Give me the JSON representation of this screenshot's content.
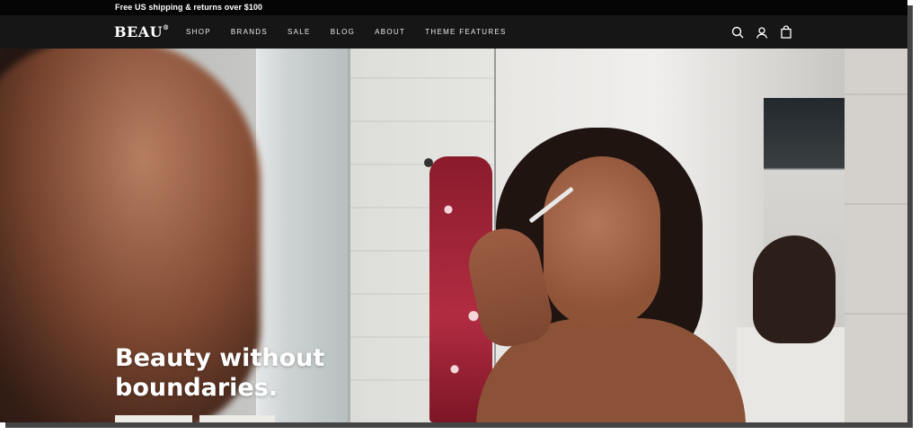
{
  "announcement": {
    "text": "Free US shipping & returns over $100"
  },
  "header": {
    "logo": "BEAU",
    "logo_mark": "®",
    "nav": [
      {
        "label": "SHOP"
      },
      {
        "label": "BRANDS"
      },
      {
        "label": "SALE"
      },
      {
        "label": "BLOG"
      },
      {
        "label": "ABOUT"
      },
      {
        "label": "THEME FEATURES"
      }
    ],
    "icons": [
      "search-icon",
      "account-icon",
      "cart-icon"
    ]
  },
  "hero": {
    "headline_line1": "Beauty without",
    "headline_line2": "boundaries."
  },
  "colors": {
    "announcement_bg": "#050505",
    "header_bg": "#161616",
    "text": "#ffffff"
  }
}
